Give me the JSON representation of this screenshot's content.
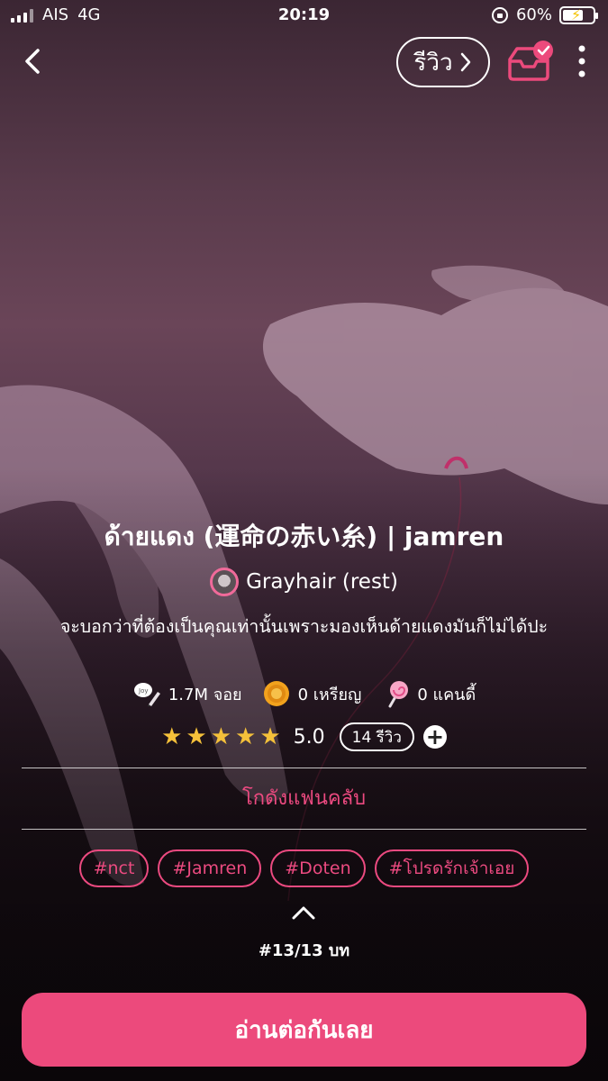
{
  "status_bar": {
    "carrier": "AIS",
    "network": "4G",
    "time": "20:19",
    "battery": "60%"
  },
  "nav": {
    "review_label": "รีวิว",
    "icons": [
      "back-icon",
      "chevron-right-icon",
      "inbox-check-icon",
      "more-vertical-icon"
    ]
  },
  "story": {
    "title": "ด้ายแดง (運命の赤い糸) | jamren",
    "author": "Grayhair (rest)",
    "description": "จะบอกว่าที่ต้องเป็นคุณเท่านั้นเพราะมองเห็นด้ายแดงมันก็ไม่ได้ปะ"
  },
  "stats": {
    "joy": "1.7M จอย",
    "coins": "0 เหรียญ",
    "candy": "0 แคนดี้"
  },
  "rating": {
    "stars": 5,
    "score": "5.0",
    "reviews": "14 รีวิว"
  },
  "fanclub": "โกดังแฟนคลับ",
  "tags": [
    "#nct",
    "#Jamren",
    "#Doten",
    "#โปรดรักเจ้าเอย"
  ],
  "episode": "#13/13 บท",
  "read_button": "อ่านต่อกันเลย",
  "colors": {
    "accent": "#ec4a7c",
    "star": "#f5c13a"
  }
}
